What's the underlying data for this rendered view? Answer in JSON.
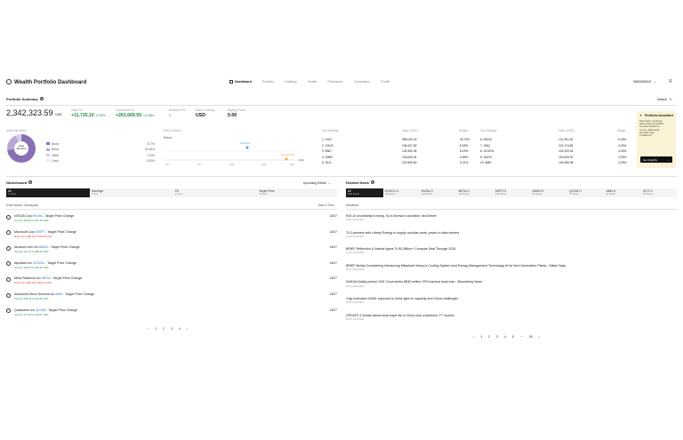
{
  "app": {
    "title": "Wealth Portfolio Dashboard",
    "user": "0583083615",
    "user_chevron": "⌄",
    "menu_icon": "hamburger-icon"
  },
  "nav": [
    "Dashboard",
    "Portfolio",
    "Holdings",
    "Health",
    "Rebalance",
    "Transaction",
    "Profile"
  ],
  "summary": {
    "title": "Portfolio Summary",
    "default_label": "Default",
    "total": "2,342,323.59",
    "total_unit": "USD",
    "daily": {
      "label": "Daily P/L",
      "value": "+11,725.10",
      "pct": "+0.50%"
    },
    "unrealized": {
      "label": "Unrealized P/L",
      "value": "+263,669.59",
      "pct": "+12.68%"
    },
    "realized": {
      "label": "Realized P/L",
      "value": "-"
    },
    "currency": {
      "label": "Base Currency",
      "value": "USD"
    },
    "buying": {
      "label": "Buying Power",
      "value": "0.00"
    }
  },
  "allocation": {
    "label": "Asset Allocation",
    "center": [
      "Asset",
      "Allocation"
    ],
    "items": [
      {
        "name": "Stock",
        "value": "73.7%",
        "color": "#8a6fb5"
      },
      {
        "name": "Bond",
        "value": "20.16%",
        "color": "#b9a6d6"
      },
      {
        "name": "Other",
        "value": "7.11%",
        "color": "#d8cbe8"
      },
      {
        "name": "Cash",
        "value": "0.02%",
        "color": "#efe7f6"
      }
    ]
  },
  "risk": {
    "label": "Risk & Return",
    "ylabel": "Return",
    "xlabel": "Risk",
    "portfolio_label": "Portfolio",
    "benchmark_label": "Benchmark",
    "ticks": [
      "0%",
      "5%",
      "10%",
      "15%",
      "20%"
    ]
  },
  "holdings": {
    "label": "Top Holdings",
    "value_label": "Value (USD)",
    "weight_label": "Weight",
    "left": [
      {
        "name": "1. VOO",
        "value": "389,030.20",
        "weight": "15.75%"
      },
      {
        "name": "2. VXUS",
        "value": "196,447.82",
        "weight": "8.05%"
      },
      {
        "name": "3. BND",
        "value": "143,450.48",
        "weight": "6.19%"
      },
      {
        "name": "4. IEMG",
        "value": "133,630.04",
        "weight": "5.55%"
      },
      {
        "name": "5. GLD",
        "value": "122,905.50",
        "weight": "5.21%"
      }
    ],
    "right": [
      {
        "name": "6. NVDA",
        "value": "121,351.52",
        "weight": "5.18%"
      },
      {
        "name": "7. VNQ",
        "value": "113,174.83",
        "weight": "4.43%"
      },
      {
        "name": "8. GOOGL",
        "value": "101,329.94",
        "weight": "4.33%"
      },
      {
        "name": "9. SGOV",
        "value": "100,525.00",
        "weight": "4.29%"
      },
      {
        "name": "10. AMD",
        "value": "100,489.48",
        "weight": "4.29%"
      }
    ]
  },
  "assistant": {
    "title": "Portfolio Assistant",
    "text": [
      "Need help monitoring,",
      "deal insight generation",
      "on better decisions",
      "can be made faster",
      "and with more",
      "confidence?"
    ],
    "button": "Get Insights",
    "arrow": "→"
  },
  "noticeboard": {
    "title": "Noticeboard",
    "filter": "Upcoming Events",
    "tabs": [
      {
        "label": "All",
        "sub": "17 items"
      },
      {
        "label": "Earnings",
        "sub": "0 items"
      },
      {
        "label": "EX",
        "sub": "4 items"
      },
      {
        "label": "Target Price",
        "sub": "14 items"
      }
    ],
    "col_left": "Event Name / Description",
    "col_right": "Date & Time",
    "items": [
      {
        "pre": "NVIDIA Corp ",
        "tk": "NVDA",
        "post": " - Target Price Change",
        "sub": "Up from 208.00 to 237.16 USD",
        "neg": false,
        "date": "14/07"
      },
      {
        "pre": "Microsoft Corp ",
        "tk": "MSFT",
        "post": " - Target Price Change",
        "sub": "Down from 588.22 to 542.36 USD",
        "neg": true,
        "date": "14/07"
      },
      {
        "pre": "Amazon.com Inc ",
        "tk": "AMZN",
        "post": " - Target Price Change",
        "sub": "Up from 247.44 to 288.12 USD",
        "neg": false,
        "date": "14/07"
      },
      {
        "pre": "Alphabet Inc ",
        "tk": "GOOGL",
        "post": " - Target Price Change",
        "sub": "Up from 203.23 to 265.10 USD",
        "neg": false,
        "date": "14/07"
      },
      {
        "pre": "Meta Platforms Inc ",
        "tk": "META",
        "post": " - Target Price Change",
        "sub": "Down from 820.79 to 802.11 USD",
        "neg": true,
        "date": "14/07"
      },
      {
        "pre": "Advanced Micro Devices Inc ",
        "tk": "AMD",
        "post": " - Target Price Change",
        "sub": "Up from 196.29 to 210.33 USD",
        "neg": false,
        "date": "14/07"
      },
      {
        "pre": "Qualcomm Inc ",
        "tk": "QCOM",
        "post": " - Target Price Change",
        "sub": "Up from 177.00 to 178.67 USD",
        "neg": false,
        "date": "14/07"
      }
    ],
    "pager": [
      "‹",
      "1",
      "2",
      "3",
      "4",
      "›"
    ]
  },
  "news": {
    "title": "Related News",
    "tabs": [
      {
        "label": "All",
        "sub": "1184 Stories"
      },
      {
        "label": "GOOGL.O",
        "sub": "139 Stories"
      },
      {
        "label": "NVDA.O",
        "sub": "148 Stories"
      },
      {
        "label": "META.O",
        "sub": "140 Stories"
      },
      {
        "label": "MSFT.O",
        "sub": "140 Stories"
      },
      {
        "label": "AMZN.O",
        "sub": "89 Stories"
      },
      {
        "label": "QCOM.O",
        "sub": "77 Stories"
      },
      {
        "label": "AMD.O",
        "sub": "64 Stories"
      },
      {
        "label": "ICCT.O",
        "sub": "58 Stories"
      }
    ],
    "col": "Headlines",
    "items": [
      {
        "title": "ROI-AI uncertainty is rising. So is investor conviction: McGeever",
        "ts": "13:04 14/07/2025"
      },
      {
        "title": "TLS partners with Liberty Energy to supply modular parts, power to data centers",
        "ts": "12:28 14/07/2025"
      },
      {
        "title": "BRIEF-Reflection & Nebius Agree To $1 Billion+ Compute Deal Through 2026",
        "ts": "12:02 14/07/2025"
      },
      {
        "title": "BRIEF-Nvidia Considering Introducing Mitsubishi Heavy's Cooling System And Energy Management Technology At Its Next Generation Plants , Nikkei Says",
        "ts": "09:21 14/07/2025"
      },
      {
        "title": "NVIDIA-Nvidia partner GMI Cloud seeks $835 million GPU-backed bank loan - Bloomberg News",
        "ts": "08:41 14/07/2025"
      },
      {
        "title": "Chip toolmaker ASML expected to shine light on capacity and China challenges",
        "ts": "07:00 14/07/2025"
      },
      {
        "title": "UPDATE 2-Nvidia halves Asia buyer list in China chip crackdown, FT reports",
        "ts": "06:55 14/07/2025"
      }
    ],
    "pager": [
      "‹",
      "1",
      "2",
      "3",
      "4",
      "5",
      "···",
      "93",
      "›"
    ]
  }
}
